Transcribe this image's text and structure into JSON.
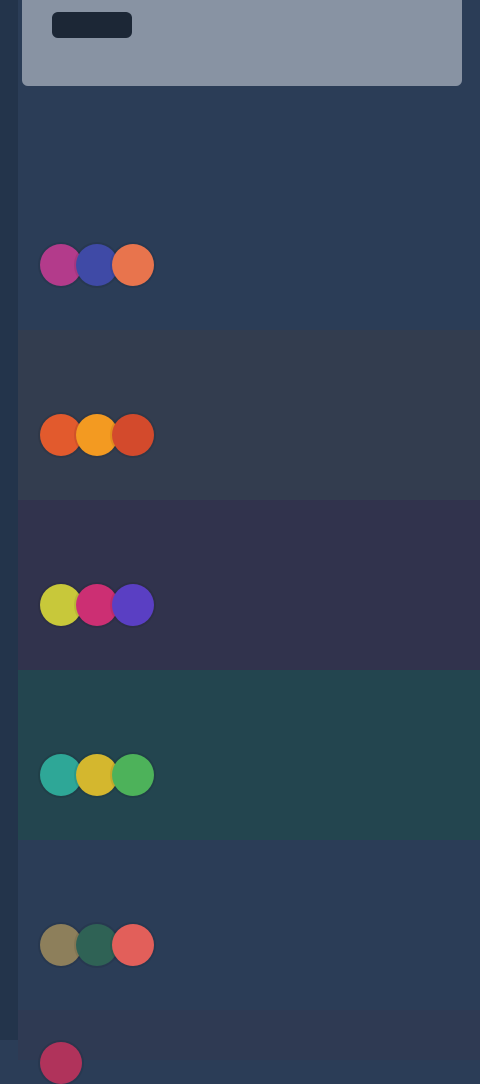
{
  "header": {
    "logo": "",
    "search_placeholder": "",
    "intro_small": "",
    "intro_title": ""
  },
  "palettes": [
    {
      "tag": "",
      "name": "",
      "bg": "#2b3d57",
      "colors": [
        "#b33b8b",
        "#3f4aa6",
        "#e8744d"
      ]
    },
    {
      "tag": "",
      "name": "",
      "bg": "#333d4f",
      "colors": [
        "#e25a2d",
        "#f39a21",
        "#d34a2c"
      ]
    },
    {
      "tag": "",
      "name": "",
      "bg": "#31334d",
      "colors": [
        "#c8c83a",
        "#cc2f73",
        "#5a3fc3"
      ]
    },
    {
      "tag": "",
      "name": "",
      "bg": "#23454f",
      "colors": [
        "#2ea797",
        "#d4b72e",
        "#4db25a"
      ]
    },
    {
      "tag": "",
      "name": "",
      "bg": "#2b3d57",
      "colors": [
        "#8d7f5b",
        "#2f6255",
        "#e25f5a"
      ]
    },
    {
      "tag": "",
      "name": "",
      "bg": "#2f3a53",
      "colors": [
        "#b0335b"
      ]
    }
  ]
}
